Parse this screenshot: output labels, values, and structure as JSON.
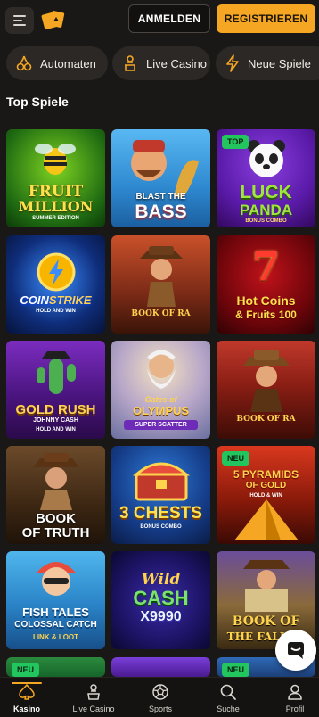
{
  "header": {
    "menu_icon": "hamburger-icon",
    "logo_icon": "cards-logo",
    "login_label": "ANMELDEN",
    "register_label": "REGISTRIEREN",
    "accent": "#f5a623"
  },
  "categories": [
    {
      "label": "Automaten",
      "icon": "cherries-icon"
    },
    {
      "label": "Live Casino",
      "icon": "dealer-icon"
    },
    {
      "label": "Neue Spiele",
      "icon": "lightning-icon"
    }
  ],
  "section_title": "Top Spiele",
  "games": [
    {
      "line1": "FRUIT",
      "line2": "MILLION",
      "line3": "SUMMER EDITION",
      "badge": ""
    },
    {
      "line1": "BLAST THE",
      "line2": "BASS",
      "line3": "",
      "badge": ""
    },
    {
      "line1": "LUCK",
      "line2": "PANDA",
      "line3": "BONUS COMBO",
      "badge": "TOP"
    },
    {
      "line1": "COIN",
      "line2": "STRIKE",
      "line3": "HOLD AND WIN",
      "badge": ""
    },
    {
      "line1": "BOOK",
      "line2": "OF RA",
      "line3": "",
      "badge": ""
    },
    {
      "line1": "Hot Coins",
      "line2": "& Fruits 100",
      "line3": "",
      "badge": ""
    },
    {
      "line1": "GOLD RUSH",
      "line2": "JOHNNY CASH",
      "line3": "HOLD AND WIN",
      "badge": ""
    },
    {
      "line1": "Gates of",
      "line2": "OLYMPUS",
      "line3": "SUPER SCATTER",
      "badge": ""
    },
    {
      "line1": "BOOK",
      "line2": "OF RA",
      "line3": "",
      "badge": ""
    },
    {
      "line1": "BOOK",
      "line2": "OF TRUTH",
      "line3": "",
      "badge": ""
    },
    {
      "line1": "3 CHESTS",
      "line2": "BONUS COMBO",
      "line3": "",
      "badge": ""
    },
    {
      "line1": "PYRAMIDS",
      "line2": "OF GOLD",
      "line3": "HOLD & WIN",
      "badge": "NEU"
    },
    {
      "line1": "FISH TALES",
      "line2": "COLOSSAL CATCH",
      "line3": "LINK & LOOT",
      "badge": ""
    },
    {
      "line1": "Wild",
      "line2": "CASH",
      "line3": "X9990",
      "badge": ""
    },
    {
      "line1": "BOOK OF",
      "line2": "THE FALLEN",
      "line3": "",
      "badge": ""
    },
    {
      "line1": "",
      "line2": "",
      "line3": "",
      "badge": "NEU"
    },
    {
      "line1": "",
      "line2": "",
      "line3": "",
      "badge": ""
    },
    {
      "line1": "",
      "line2": "",
      "line3": "",
      "badge": "NEU"
    }
  ],
  "chat_icon": "chat-icon",
  "bottom_nav": [
    {
      "label": "Kasino",
      "icon": "spade-icon",
      "active": true
    },
    {
      "label": "Live Casino",
      "icon": "dealer-icon",
      "active": false
    },
    {
      "label": "Sports",
      "icon": "soccer-ball-icon",
      "active": false
    },
    {
      "label": "Suche",
      "icon": "search-icon",
      "active": false
    },
    {
      "label": "Profil",
      "icon": "user-icon",
      "active": false
    }
  ]
}
